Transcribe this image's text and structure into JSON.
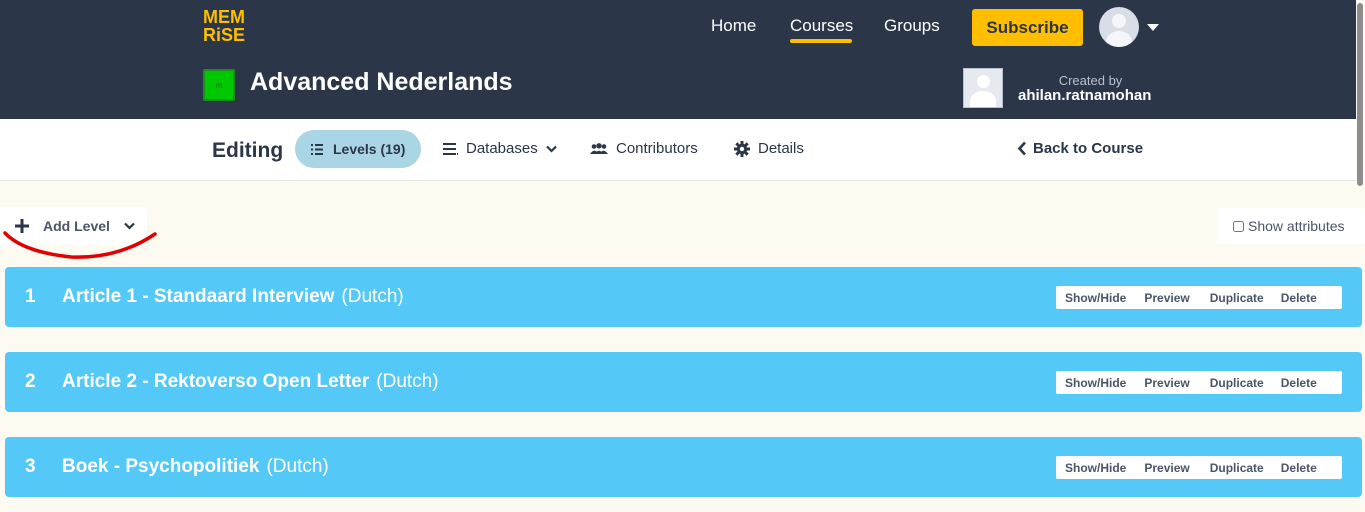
{
  "header": {
    "logo_line1": "MEM",
    "logo_line2": "RiSE",
    "nav": {
      "home": "Home",
      "courses": "Courses",
      "groups": "Groups"
    },
    "subscribe_label": "Subscribe",
    "course_title": "Advanced Nederlands",
    "course_icon_text": "m",
    "created_by_label": "Created by",
    "creator_name": "ahilan.ratnamohan"
  },
  "editbar": {
    "editing_label": "Editing",
    "tabs": {
      "levels": "Levels (19)",
      "databases": "Databases",
      "contributors": "Contributors",
      "details": "Details"
    },
    "back_label": "Back to Course"
  },
  "toolbar": {
    "add_level_label": "Add Level",
    "show_attributes_label": "Show attributes"
  },
  "levels": [
    {
      "number": "1",
      "title": "Article 1 - Standaard Interview",
      "language": "(Dutch)"
    },
    {
      "number": "2",
      "title": "Article 2 - Rektoverso Open Letter",
      "language": "(Dutch)"
    },
    {
      "number": "3",
      "title": "Boek - Psychopolitiek",
      "language": "(Dutch)"
    }
  ],
  "level_actions": {
    "show_hide": "Show/Hide",
    "preview": "Preview",
    "duplicate": "Duplicate",
    "delete": "Delete"
  },
  "colors": {
    "header_bg": "#2b3648",
    "accent": "#ffbe00",
    "level_bg": "#54c8f7",
    "active_tab_bg": "#a9d5e4",
    "page_bg": "#fdfaf1",
    "annotation": "#e00000"
  }
}
